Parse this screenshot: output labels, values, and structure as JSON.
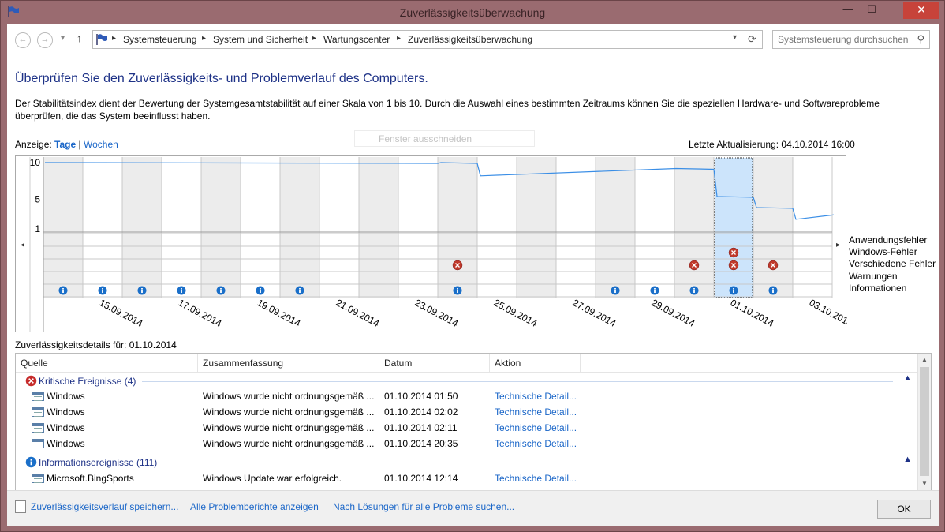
{
  "window": {
    "title": "Zuverlässigkeitsüberwachung",
    "minimize": "—",
    "maximize": "☐",
    "close": "✕"
  },
  "nav": {
    "back": "←",
    "forward": "→",
    "up": "↑",
    "breadcrumbs": [
      "Systemsteuerung",
      "System und Sicherheit",
      "Wartungscenter",
      "Zuverlässigkeitsüberwachung"
    ],
    "search_placeholder": "Systemsteuerung durchsuchen"
  },
  "page": {
    "heading": "Überprüfen Sie den Zuverlässigkeits- und Problemverlauf des Computers.",
    "description": "Der Stabilitätsindex dient der Bewertung der Systemgesamtstabilität auf einer Skala von 1 bis 10. Durch die Auswahl eines bestimmten Zeitraums können Sie die speziellen Hardware- und Softwareprobleme überprüfen, die das System beeinflusst haben.",
    "view_label": "Anzeige:",
    "view_days": "Tage",
    "view_sep": "|",
    "view_weeks": "Wochen",
    "ghost_text": "Fenster ausschneiden",
    "last_update": "Letzte Aktualisierung: 04.10.2014 16:00"
  },
  "chart_data": {
    "type": "line",
    "y_ticks": [
      "10",
      "5",
      "1"
    ],
    "ylim": [
      0,
      10
    ],
    "x": [
      "14.09.2014",
      "15.09.2014",
      "16.09.2014",
      "17.09.2014",
      "18.09.2014",
      "19.09.2014",
      "20.09.2014",
      "21.09.2014",
      "22.09.2014",
      "23.09.2014",
      "24.09.2014",
      "25.09.2014",
      "26.09.2014",
      "27.09.2014",
      "28.09.2014",
      "29.09.2014",
      "30.09.2014",
      "01.10.2014",
      "02.10.2014",
      "03.10.2014"
    ],
    "x_tick_labels": [
      "15.09.2014",
      "17.09.2014",
      "19.09.2014",
      "21.09.2014",
      "23.09.2014",
      "25.09.2014",
      "27.09.2014",
      "29.09.2014",
      "01.10.2014",
      "03.10.2014"
    ],
    "stability_index": [
      {
        "date": "14.09.2014",
        "value": 10.0
      },
      {
        "date": "24.09.2014",
        "value": 10.0
      },
      {
        "date": "25.09.2014",
        "value": 8.2
      },
      {
        "date": "30.09.2014",
        "value": 9.2
      },
      {
        "date": "01.10.2014",
        "value": 5.4
      },
      {
        "date": "02.10.2014",
        "value": 3.9
      },
      {
        "date": "03.10.2014",
        "value": 2.3
      },
      {
        "date": "04.10.2014",
        "value": 2.9
      }
    ],
    "selected_day": "01.10.2014",
    "event_rows": [
      "Anwendungsfehler",
      "Windows-Fehler",
      "Verschiedene Fehler",
      "Warnungen",
      "Informationen"
    ],
    "events": [
      {
        "date": "14.09.2014",
        "row": "Informationen",
        "kind": "info"
      },
      {
        "date": "15.09.2014",
        "row": "Informationen",
        "kind": "info"
      },
      {
        "date": "16.09.2014",
        "row": "Informationen",
        "kind": "info"
      },
      {
        "date": "17.09.2014",
        "row": "Informationen",
        "kind": "info"
      },
      {
        "date": "18.09.2014",
        "row": "Informationen",
        "kind": "info"
      },
      {
        "date": "19.09.2014",
        "row": "Informationen",
        "kind": "info"
      },
      {
        "date": "20.09.2014",
        "row": "Informationen",
        "kind": "info"
      },
      {
        "date": "24.09.2014",
        "row": "Verschiedene Fehler",
        "kind": "error"
      },
      {
        "date": "24.09.2014",
        "row": "Informationen",
        "kind": "info"
      },
      {
        "date": "28.09.2014",
        "row": "Informationen",
        "kind": "info"
      },
      {
        "date": "29.09.2014",
        "row": "Informationen",
        "kind": "info"
      },
      {
        "date": "30.09.2014",
        "row": "Verschiedene Fehler",
        "kind": "error"
      },
      {
        "date": "30.09.2014",
        "row": "Informationen",
        "kind": "info"
      },
      {
        "date": "01.10.2014",
        "row": "Windows-Fehler",
        "kind": "error"
      },
      {
        "date": "01.10.2014",
        "row": "Verschiedene Fehler",
        "kind": "error"
      },
      {
        "date": "01.10.2014",
        "row": "Informationen",
        "kind": "info"
      },
      {
        "date": "02.10.2014",
        "row": "Verschiedene Fehler",
        "kind": "error"
      },
      {
        "date": "02.10.2014",
        "row": "Informationen",
        "kind": "info"
      }
    ],
    "colors": {
      "line": "#3a8ee6",
      "shaded": "#ececec",
      "selected": "#cce4fb",
      "grid": "#c8c8c8",
      "error": "#c0392b",
      "info": "#1a6fc9"
    }
  },
  "details": {
    "label": "Zuverlässigkeitsdetails für: 01.10.2014",
    "columns": [
      "Quelle",
      "Zusammenfassung",
      "Datum",
      "Aktion"
    ],
    "groups": [
      {
        "title": "Kritische Ereignisse (4)",
        "icon": "error-icon",
        "rows": [
          {
            "source": "Windows",
            "summary": "Windows wurde nicht ordnungsgemäß ...",
            "date": "01.10.2014 01:50",
            "action": "Technische Detail..."
          },
          {
            "source": "Windows",
            "summary": "Windows wurde nicht ordnungsgemäß ...",
            "date": "01.10.2014 02:02",
            "action": "Technische Detail..."
          },
          {
            "source": "Windows",
            "summary": "Windows wurde nicht ordnungsgemäß ...",
            "date": "01.10.2014 02:11",
            "action": "Technische Detail..."
          },
          {
            "source": "Windows",
            "summary": "Windows wurde nicht ordnungsgemäß ...",
            "date": "01.10.2014 20:35",
            "action": "Technische Detail..."
          }
        ]
      },
      {
        "title": "Informationsereignisse (111)",
        "icon": "info-icon",
        "rows": [
          {
            "source": "Microsoft.BingSports",
            "summary": "Windows Update war erfolgreich.",
            "date": "01.10.2014 12:14",
            "action": "Technische Detail..."
          }
        ]
      }
    ]
  },
  "footer": {
    "save_link": "Zuverlässigkeitsverlauf speichern...",
    "reports_link": "Alle Problemberichte anzeigen",
    "solutions_link": "Nach Lösungen für alle Probleme suchen...",
    "ok": "OK"
  }
}
